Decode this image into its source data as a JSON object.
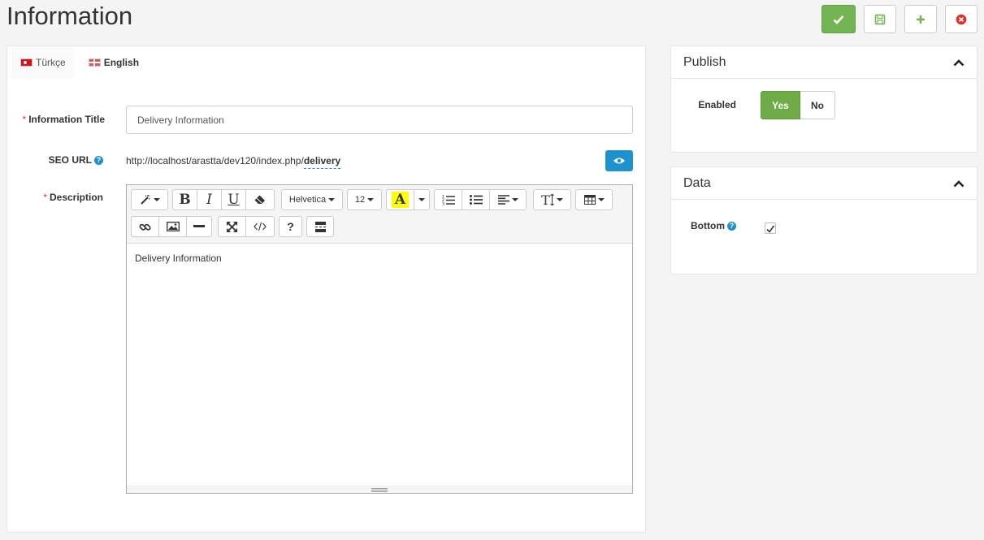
{
  "page": {
    "title": "Information"
  },
  "tabs": [
    {
      "label": "Türkçe",
      "active": true
    },
    {
      "label": "English",
      "active": false
    }
  ],
  "form": {
    "title_label": "Information Title",
    "title_value": "Delivery Information",
    "seo_label": "SEO URL",
    "seo_prefix": "http://localhost/arastta/dev120/index.php/",
    "seo_keyword": "delivery",
    "description_label": "Description",
    "required_mark": "*",
    "help_mark": "?"
  },
  "editor": {
    "font_name": "Helvetica",
    "font_size": "12",
    "color_letter": "A",
    "bold": "B",
    "italic": "I",
    "underline": "U",
    "help": "?",
    "content": "Delivery Information",
    "highlight_color": "#ffff00"
  },
  "publish": {
    "title": "Publish",
    "enabled_label": "Enabled",
    "yes": "Yes",
    "no": "No",
    "enabled": true
  },
  "data_panel": {
    "title": "Data",
    "bottom_label": "Bottom",
    "help_mark": "?",
    "bottom_checked": true
  },
  "colors": {
    "primary_green": "#72b552",
    "info_blue": "#1e91cf",
    "danger_red": "#d9534f"
  }
}
